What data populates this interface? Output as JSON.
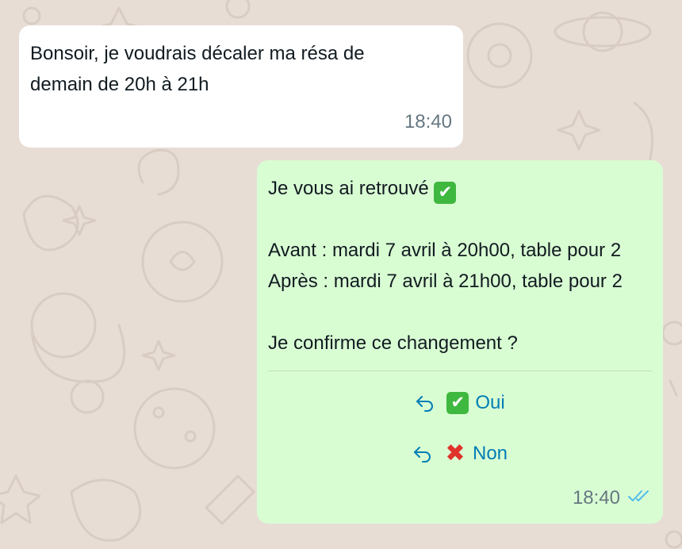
{
  "incoming_message": {
    "lines": [
      "Bonsoir, je voudrais décaler ma résa de",
      "demain de 20h à 21h"
    ],
    "time": "18:40"
  },
  "outgoing_message": {
    "line1": "Je vous ai retrouvé",
    "line1_emoji": "✔",
    "line2": "Avant : mardi 7 avril à 20h00, table pour 2",
    "line3": "Après : mardi 7 avril à 21h00, table pour 2",
    "line4": "Je confirme ce changement ?",
    "time": "18:40",
    "status_icon": "double-check-read"
  },
  "quick_replies": [
    {
      "emoji": "✔",
      "label": "Oui",
      "icon": "reply-arrow-icon"
    },
    {
      "emoji": "✖",
      "label": "Non",
      "icon": "reply-arrow-icon"
    }
  ],
  "colors": {
    "background": "#e8ddd5",
    "incoming_bubble": "#ffffff",
    "outgoing_bubble": "#d9fdd3",
    "reply_link": "#027eb5",
    "timestamp": "#667781",
    "read_ticks": "#53bdeb"
  }
}
